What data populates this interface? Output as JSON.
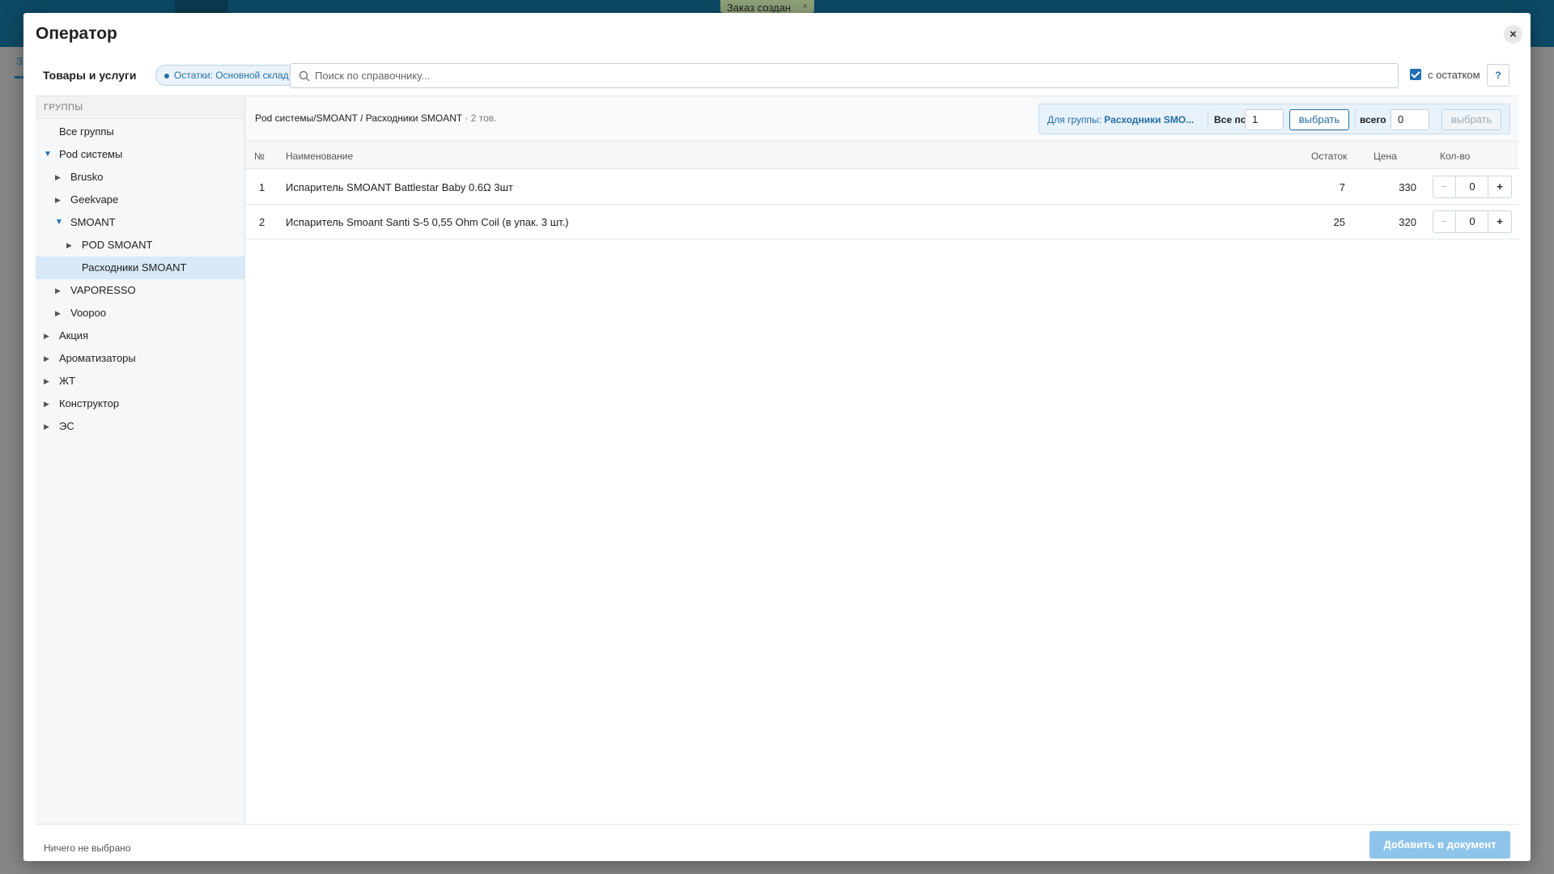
{
  "background": {
    "toast_label": "Заказ создан",
    "toast_close": "×",
    "side_text": "З"
  },
  "modal": {
    "title": "Оператор",
    "close_glyph": "×"
  },
  "toolbar": {
    "label": "Товары и услуги",
    "stock_pill": "Остатки: Основной склад",
    "search_placeholder": "Поиск по справочнику...",
    "search_value": "",
    "with_stock_label": "с остатком",
    "with_stock_checked": true,
    "help_label": "?"
  },
  "sidebar": {
    "header": "ГРУППЫ",
    "items": [
      {
        "label": "Все группы",
        "level": 0,
        "arrow": ""
      },
      {
        "label": "Pod системы",
        "level": 0,
        "arrow": "▼"
      },
      {
        "label": "Brusko",
        "level": 1,
        "arrow": "▶"
      },
      {
        "label": "Geekvape",
        "level": 1,
        "arrow": "▶"
      },
      {
        "label": "SMOANT",
        "level": 1,
        "arrow": "▼"
      },
      {
        "label": "POD SMOANT",
        "level": 2,
        "arrow": "▶"
      },
      {
        "label": "Расходники SMOANT",
        "level": 2,
        "arrow": "",
        "selected": true
      },
      {
        "label": "VAPORESSO",
        "level": 1,
        "arrow": "▶"
      },
      {
        "label": "Voopoo",
        "level": 1,
        "arrow": "▶"
      },
      {
        "label": "Акция",
        "level": 0,
        "arrow": "▶"
      },
      {
        "label": "Ароматизаторы",
        "level": 0,
        "arrow": "▶"
      },
      {
        "label": "ЖТ",
        "level": 0,
        "arrow": "▶"
      },
      {
        "label": "Конструктор",
        "level": 0,
        "arrow": "▶"
      },
      {
        "label": "ЭС",
        "level": 0,
        "arrow": "▶"
      }
    ]
  },
  "content": {
    "breadcrumb": "Pod системы/SMOANT / Расходники SMOANT",
    "count": " · 2 тов.",
    "group_panel": {
      "for_group_prefix": "Для группы: ",
      "for_group_name": "Расходники SMO...",
      "all_by_label": "Все по",
      "all_by_value": "1",
      "select_label": "выбрать",
      "total_label": "всего",
      "total_value": "0",
      "select2_label": "выбрать"
    },
    "columns": {
      "num": "№",
      "name": "Наименование",
      "stock": "Остаток",
      "price": "Цена",
      "qty": "Кол-во"
    },
    "rows": [
      {
        "num": "1",
        "name": "Испаритель SMOANT Battlestar Baby 0.6Ω 3шт",
        "stock": "7",
        "price": "330",
        "qty": "0"
      },
      {
        "num": "2",
        "name": "Испаритель Smoant Santi S-5 0,55 Ohm Coil (в упак. 3 шт.)",
        "stock": "25",
        "price": "320",
        "qty": "0"
      }
    ]
  },
  "footer": {
    "status": "Ничего не выбрано",
    "add_button": "Добавить в документ"
  },
  "colors": {
    "accent": "#246fa6",
    "selected_bg": "#d8e9f7",
    "primary_disabled": "#8ec4ea"
  }
}
